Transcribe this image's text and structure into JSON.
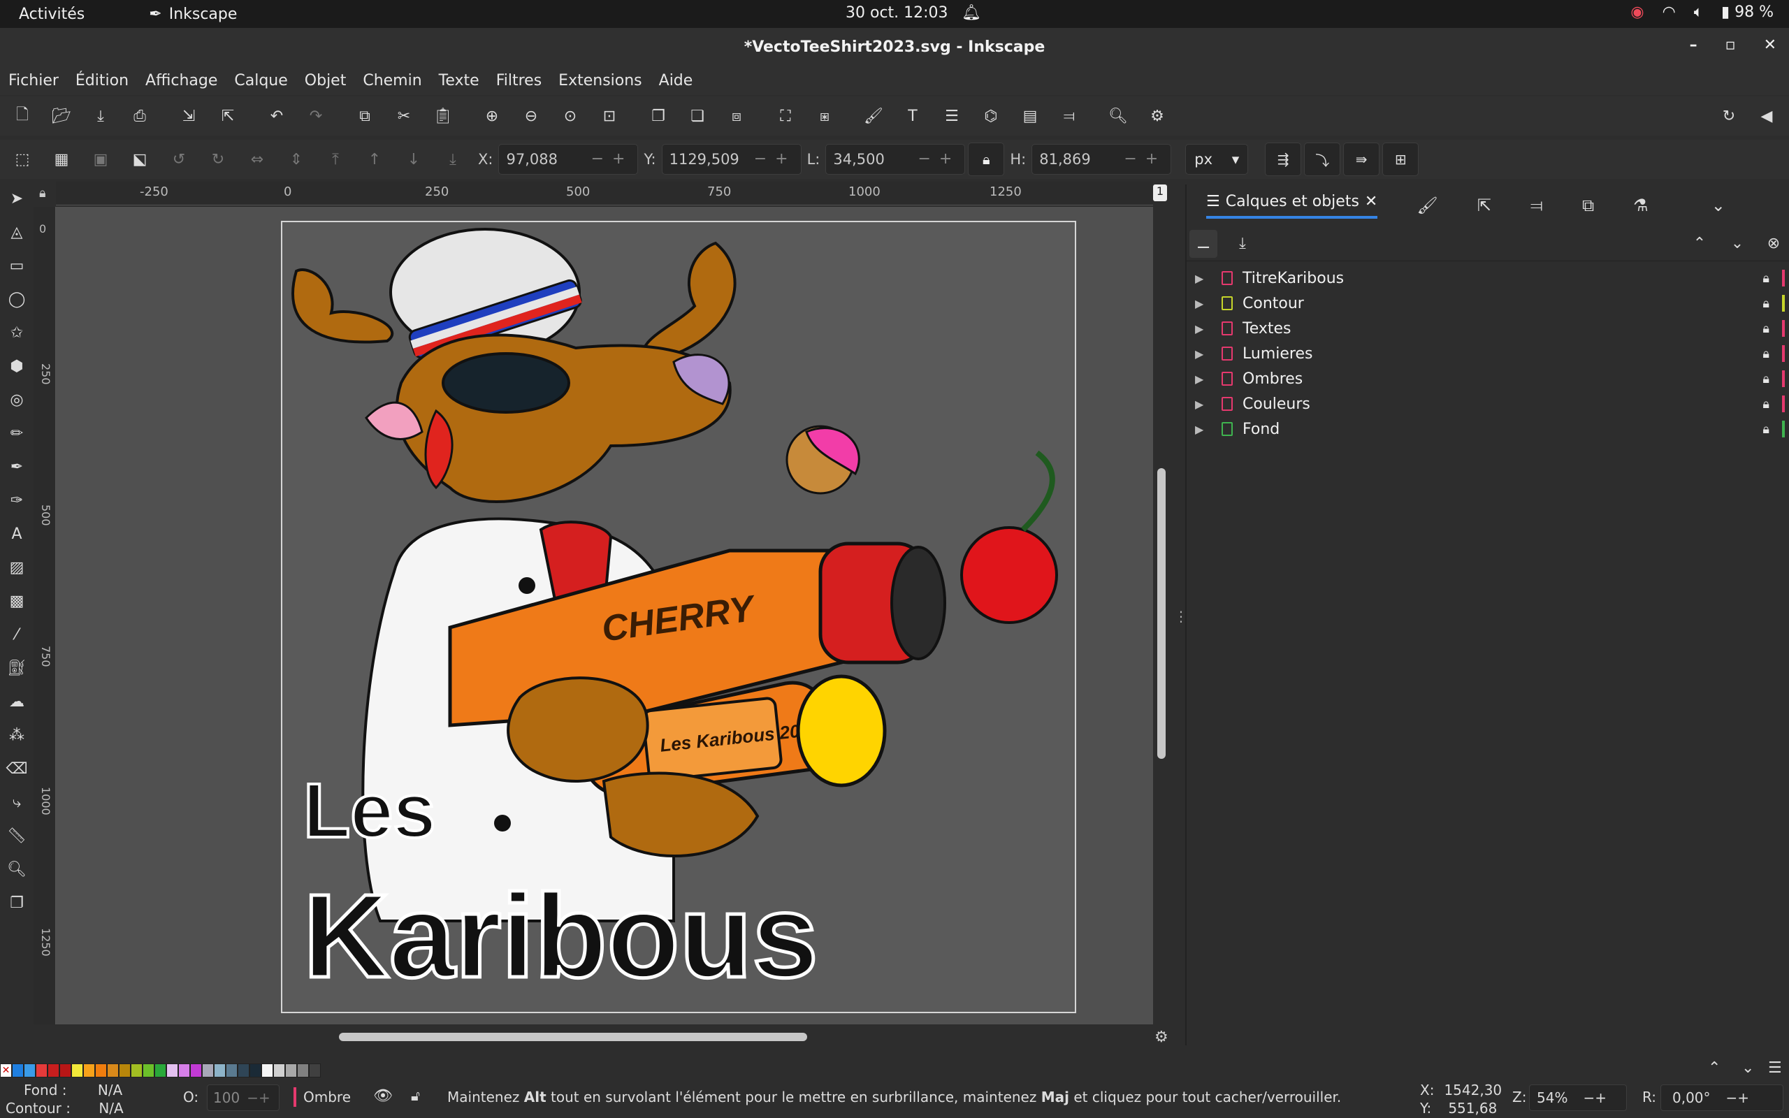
{
  "topbar": {
    "activities": "Activités",
    "app_name": "Inkscape",
    "clock": "30 oct.  12:03",
    "battery": "98 %"
  },
  "window": {
    "title": "*VectoTeeShirt2023.svg - Inkscape"
  },
  "menu": {
    "items": [
      "Fichier",
      "Édition",
      "Affichage",
      "Calque",
      "Objet",
      "Chemin",
      "Texte",
      "Filtres",
      "Extensions",
      "Aide"
    ]
  },
  "controls": {
    "x_label": "X:",
    "x_value": "97,088",
    "y_label": "Y:",
    "y_value": "1129,509",
    "w_label": "L:",
    "w_value": "34,500",
    "h_label": "H:",
    "h_value": "81,869",
    "unit": "px"
  },
  "rulers": {
    "h_ticks": [
      "-250",
      "0",
      "250",
      "500",
      "750",
      "1000",
      "1250"
    ],
    "v_ticks": [
      "0",
      "250",
      "500",
      "750",
      "1000",
      "1250"
    ],
    "page_badge": "1"
  },
  "artwork": {
    "title_small": "Les",
    "title_big": "Karibous",
    "gun_label": "CHERRY",
    "gun_plate": "Les Karibous 2023"
  },
  "panel": {
    "tab_label": "Calques et objets",
    "layers": [
      {
        "name": "TitreKaribous",
        "color": "#e5396e",
        "strip": "#e5396e"
      },
      {
        "name": "Contour",
        "color": "#c6d52a",
        "strip": "#c6d52a"
      },
      {
        "name": "Textes",
        "color": "#e5396e",
        "strip": "#e5396e"
      },
      {
        "name": "Lumieres",
        "color": "#e5396e",
        "strip": "#e5396e"
      },
      {
        "name": "Ombres",
        "color": "#e5396e",
        "strip": "#e5396e"
      },
      {
        "name": "Couleurs",
        "color": "#e5396e",
        "strip": "#e5396e"
      },
      {
        "name": "Fond",
        "color": "#3fb34f",
        "strip": "#3fb34f"
      }
    ]
  },
  "palette": [
    "#1f7fe0",
    "#3a9be8",
    "#e53a3a",
    "#c81e1e",
    "#b81616",
    "#f2e83a",
    "#f7a21a",
    "#f07d0e",
    "#d9891a",
    "#b8860b",
    "#a2be22",
    "#6cc02a",
    "#2aa83a",
    "#e3c0f0",
    "#d67fe8",
    "#c23ad4",
    "#a8a8b8",
    "#8db3c8",
    "#5a7a90",
    "#2f4556",
    "#1a2a36",
    "#f5f5f5",
    "#d0d0d0",
    "#a8a8a8",
    "#808080",
    "#404040"
  ],
  "status": {
    "fill_label": "Fond :",
    "fill_value": "N/A",
    "stroke_label": "Contour :",
    "stroke_value": "N/A",
    "opacity_label": "O:",
    "opacity_value": "100",
    "layer_name": "Ombre",
    "message_1": "Maintenez ",
    "message_alt": "Alt",
    "message_2": " tout en survolant l'élément pour le mettre en surbrillance, maintenez ",
    "message_maj": "Maj",
    "message_3": " et cliquez pour tout cacher/verrouiller.",
    "cx_label": "X:",
    "cx_value": "1542,30",
    "cy_label": "Y:",
    "cy_value": "551,68",
    "zoom_label": "Z:",
    "zoom_value": "54%",
    "rot_label": "R:",
    "rot_value": "0,00°"
  }
}
